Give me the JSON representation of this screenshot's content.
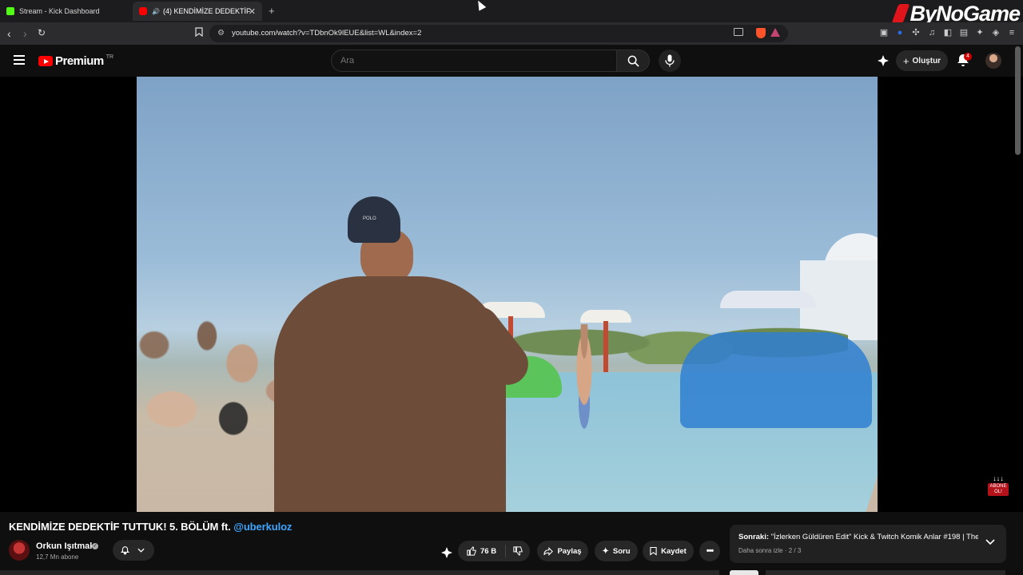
{
  "browser": {
    "tabs": [
      {
        "label": "Stream - Kick Dashboard",
        "icon": "kick-icon",
        "active": false
      },
      {
        "label": "(4) KENDİMİZE DEDEKTİF TUT",
        "icon": "youtube-icon",
        "active": true
      }
    ],
    "url": "youtube.com/watch?v=TDbnOk9lEUE&list=WL&index=2",
    "watermark": "ByNoGame"
  },
  "youtube": {
    "logo_text": "Premium",
    "region": "TR",
    "search_placeholder": "Ara",
    "create_label": "Oluştur",
    "notification_count": "4"
  },
  "video": {
    "cap_text": "POLO",
    "subscribe_badge_top": "↓↓↓",
    "subscribe_badge": "ABONE OL!"
  },
  "info": {
    "title": "KENDİMİZE DEDEKTİF TUTTUK! 5. BÖLÜM ft.",
    "title_tag": "@uberkuloz",
    "channel_name": "Orkun Işıtmak",
    "subscribers": "12,7 Mn abone",
    "like_count": "76 B",
    "share_label": "Paylaş",
    "ask_label": "Soru",
    "save_label": "Kaydet"
  },
  "up_next": {
    "prefix": "Sonraki:",
    "title": "\"İzlerken Güldüren Edit\" Kick & Twitch Komik Anlar #198 | The ...",
    "subtitle": "Daha sonra izle · 2 / 3"
  },
  "colors": {
    "accent": "#ff0000",
    "link": "#3ea6ff",
    "kick": "#53fc18"
  }
}
